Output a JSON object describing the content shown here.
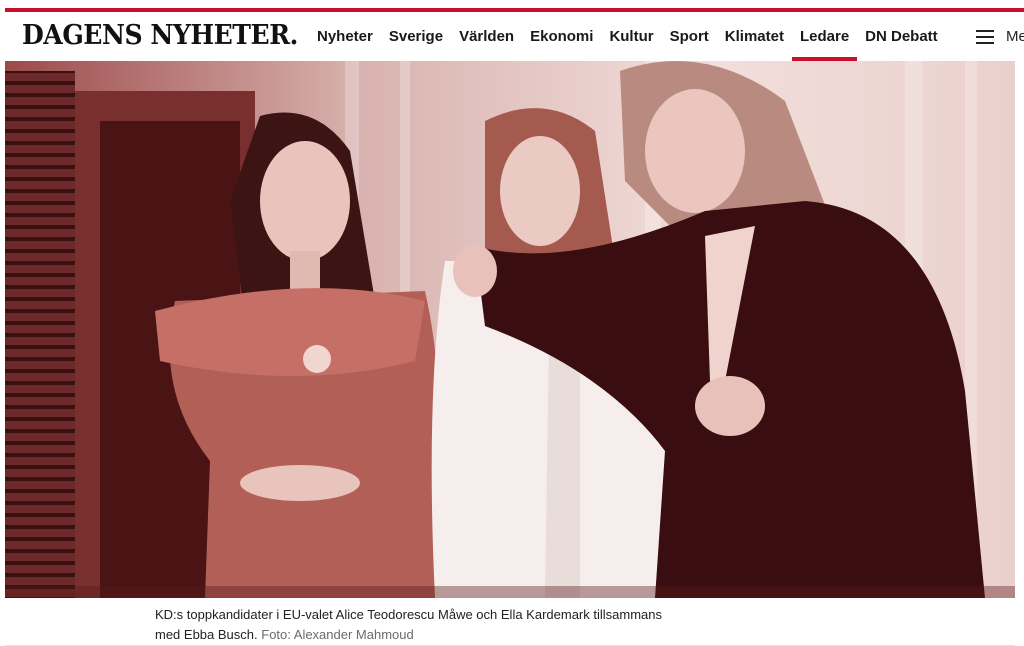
{
  "header": {
    "logo_text": "DAGENS NYHETER.",
    "nav": [
      {
        "label": "Nyheter"
      },
      {
        "label": "Sverige"
      },
      {
        "label": "Världen"
      },
      {
        "label": "Ekonomi"
      },
      {
        "label": "Kultur"
      },
      {
        "label": "Sport"
      },
      {
        "label": "Klimatet"
      },
      {
        "label": "Ledare",
        "active": true
      },
      {
        "label": "DN Debatt"
      }
    ],
    "menu_label": "Me",
    "menu_icon": "hamburger-menu-icon"
  },
  "article": {
    "caption": "KD:s toppkandidater i EU-valet Alice Teodorescu Måwe och Ella Kardemark tillsammans med Ebba Busch.",
    "credit": "Foto: Alexander Mahmoud"
  },
  "colors": {
    "brand_red": "#c8102e",
    "photo_tint": "#8b1a1a"
  }
}
